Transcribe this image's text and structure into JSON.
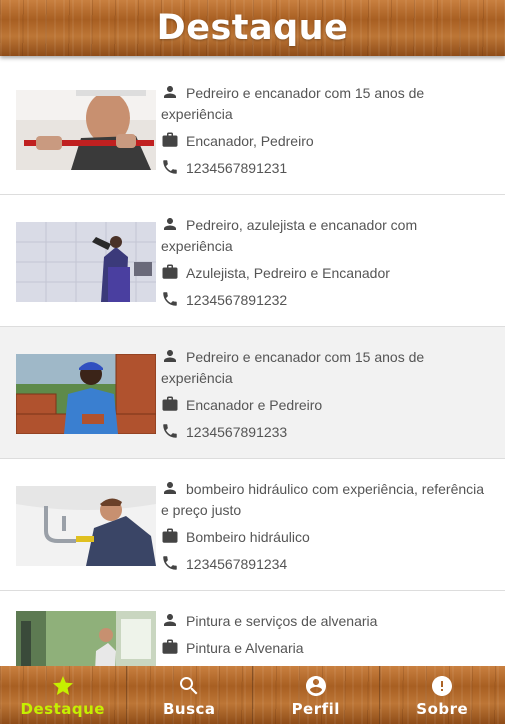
{
  "header": {
    "title": "Destaque"
  },
  "listings": [
    {
      "description": "Pedreiro e encanador com 15 anos de experiência",
      "professions": "Encanador, Pedreiro",
      "phone": "1234567891231",
      "image": "plumber-red-pipe-wrench-photo"
    },
    {
      "description": "Pedreiro, azulejista e encanador com experiência",
      "professions": "Azulejista, Pedreiro e Encanador",
      "phone": "1234567891232",
      "image": "worker-tiling-wall-photo"
    },
    {
      "description": "Pedreiro e encanador com 15 anos de experiência",
      "professions": "Encanador e Pedreiro",
      "phone": "1234567891233",
      "image": "bricklayer-blue-helmet-photo"
    },
    {
      "description": "bombeiro hidráulico com experiência, referência e preço justo",
      "professions": "Bombeiro hidráulico",
      "phone": "1234567891234",
      "image": "plumber-under-sink-photo"
    },
    {
      "description": "Pintura e serviços de alvenaria",
      "professions": "Pintura e Alvenaria",
      "phone": "",
      "image": "painter-green-room-photo"
    }
  ],
  "icons": {
    "description": "person-icon",
    "professions": "briefcase-icon",
    "phone": "phone-icon"
  },
  "tabs": [
    {
      "label": "Destaque",
      "icon": "star-icon",
      "active": true
    },
    {
      "label": "Busca",
      "icon": "search-icon",
      "active": false
    },
    {
      "label": "Perfil",
      "icon": "account-circle-icon",
      "active": false
    },
    {
      "label": "Sobre",
      "icon": "info-icon",
      "active": false
    }
  ],
  "colors": {
    "active_tab_label": "#c6f000",
    "text": "#555555",
    "icon": "#444444"
  }
}
